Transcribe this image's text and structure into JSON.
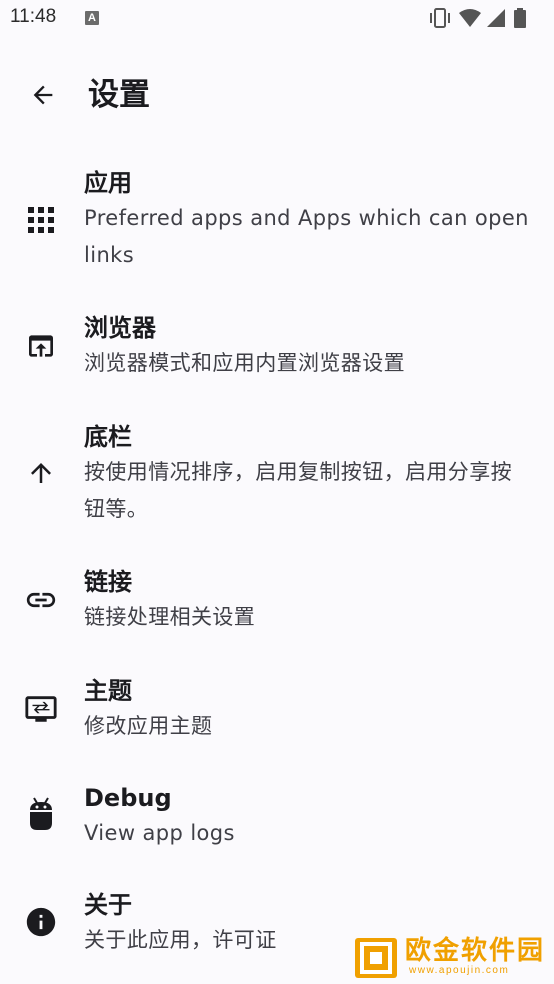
{
  "status_bar": {
    "time": "11:48",
    "notification_badge": "A",
    "icons": [
      "vibrate-icon",
      "wifi-icon",
      "signal-icon",
      "battery-icon"
    ]
  },
  "app_bar": {
    "back_icon": "arrow-back-icon",
    "title": "设置"
  },
  "settings": {
    "items": [
      {
        "icon": "apps-grid-icon",
        "title": "应用",
        "subtitle": "Preferred apps and Apps which can open links"
      },
      {
        "icon": "open-in-browser-icon",
        "title": "浏览器",
        "subtitle": "浏览器模式和应用内置浏览器设置"
      },
      {
        "icon": "arrow-upward-icon",
        "title": "底栏",
        "subtitle": "按使用情况排序，启用复制按钮，启用分享按钮等。"
      },
      {
        "icon": "link-icon",
        "title": "链接",
        "subtitle": "链接处理相关设置"
      },
      {
        "icon": "theme-display-icon",
        "title": "主题",
        "subtitle": "修改应用主题"
      },
      {
        "icon": "android-bug-icon",
        "title": "Debug",
        "subtitle": "View app logs"
      },
      {
        "icon": "info-icon",
        "title": "关于",
        "subtitle": "关于此应用，许可证"
      }
    ]
  },
  "watermark": {
    "name": "欧金软件园",
    "url": "www.apoujin.com"
  },
  "colors": {
    "background": "#fbfafd",
    "text_primary": "#1b1b1f",
    "text_secondary": "#3f3f46",
    "icon": "#1b1b1f",
    "watermark": "#f0a000"
  }
}
